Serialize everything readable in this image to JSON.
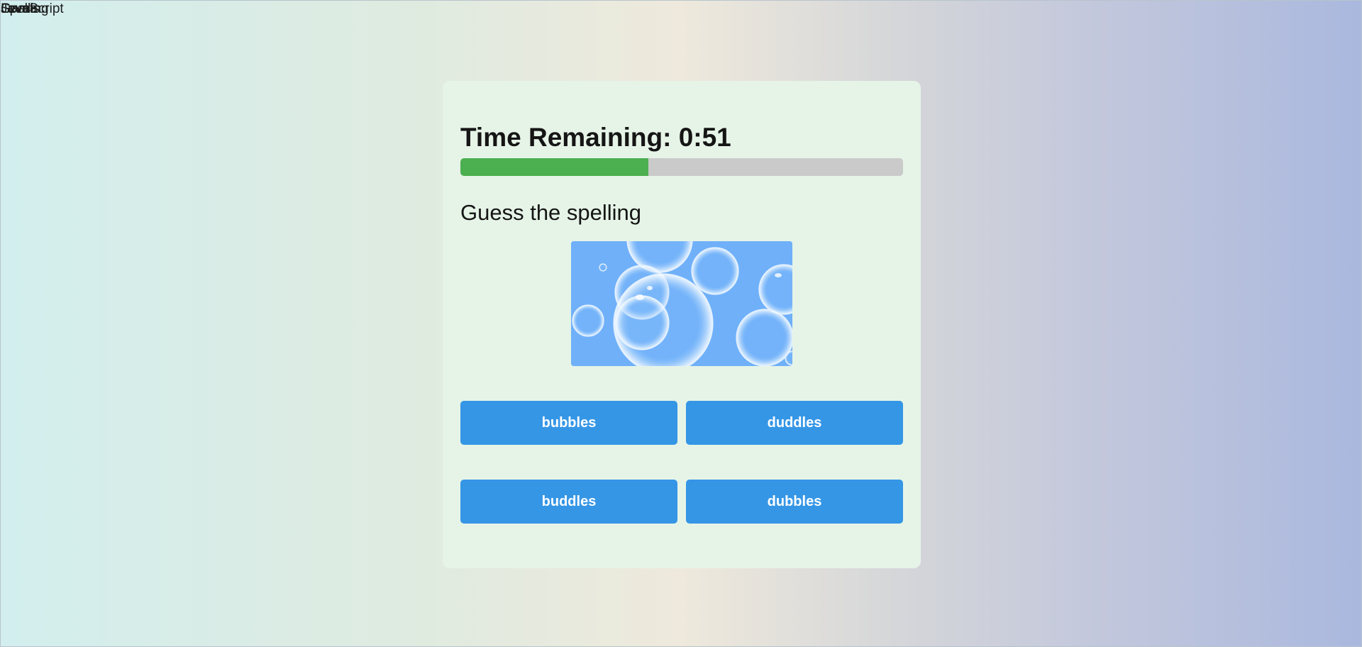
{
  "overlay_text": [
    "Game",
    "Levels",
    "Spelling",
    "JavaScript"
  ],
  "timer": {
    "label": "Time Remaining: 0:51",
    "progress_fraction": 0.425
  },
  "question": {
    "prompt": "Guess the spelling",
    "image_subject": "bubbles"
  },
  "choices": [
    "bubbles",
    "duddles",
    "buddles",
    "dubbles"
  ],
  "colors": {
    "progress_fill": "#4caf50",
    "progress_track": "#cacaca",
    "button": "#3596e6",
    "card": "#e6f4e7"
  }
}
